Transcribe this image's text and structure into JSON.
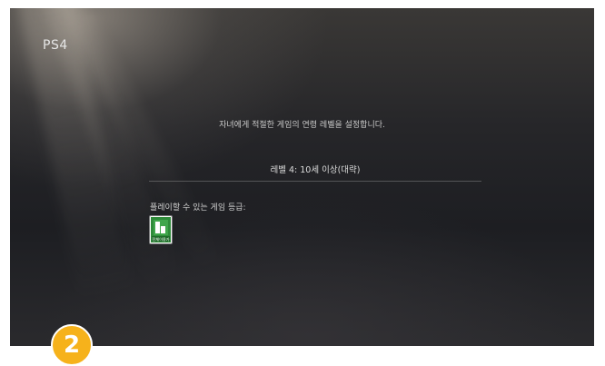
{
  "header": {
    "brand": "PS4"
  },
  "main": {
    "headline": "자녀에게 적절한 게임의 연령 레벨을 설정합니다.",
    "level_setting": "레벨 4: 10세 이상(대략)",
    "allowed_ratings_label": "플레이할 수 있는 게임 등급:",
    "rating_badges": [
      {
        "icon": "rating-all-ages-icon",
        "text": "전체이용가",
        "color": "#2e8b3a"
      }
    ]
  },
  "overlay": {
    "step_number": "2",
    "color": "#f6b21b"
  }
}
